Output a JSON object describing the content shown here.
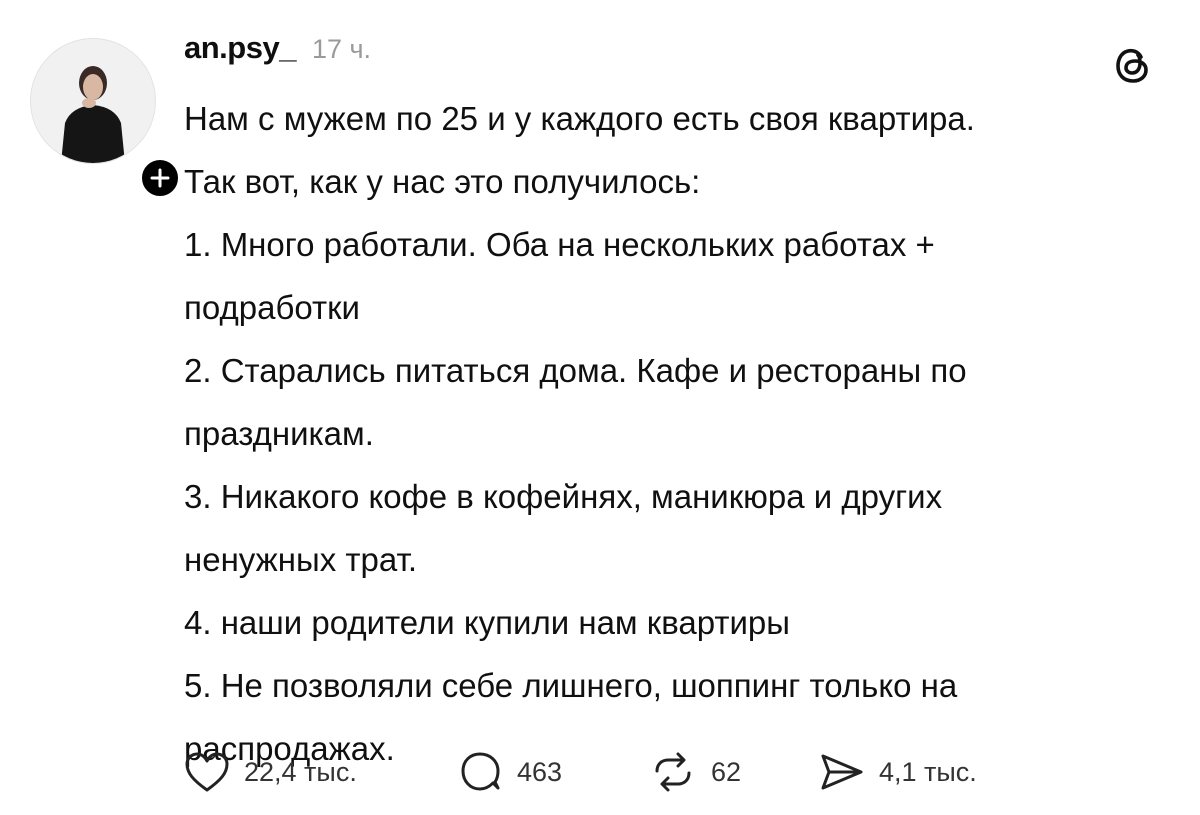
{
  "post": {
    "username": "an.psy_",
    "time": "17 ч.",
    "lines": [
      "Нам с мужем по 25 и у каждого есть своя квартира.",
      "Так вот, как у нас это получилось:",
      "1. Много работали. Оба на нескольких работах +",
      "подработки",
      "2. Старались питаться дома. Кафе и рестораны по",
      "праздникам.",
      "3. Никакого кофе в кофейнях, маникюра и других",
      "ненужных трат.",
      "4. наши родители купили нам квартиры",
      "5. Не позволяли себе лишнего, шоппинг только на",
      "распродажах."
    ]
  },
  "actions": {
    "likes": "22,4 тыс.",
    "replies": "463",
    "reposts": "62",
    "shares": "4,1 тыс."
  },
  "icons": {
    "app_logo": "threads-logo-icon",
    "follow": "plus-icon",
    "like": "heart-icon",
    "reply": "speech-bubble-icon",
    "repost": "repost-icon",
    "share": "send-icon"
  },
  "colors": {
    "text": "#101010",
    "muted": "#9a9a9a",
    "icon": "#222222",
    "badge": "#000000"
  }
}
